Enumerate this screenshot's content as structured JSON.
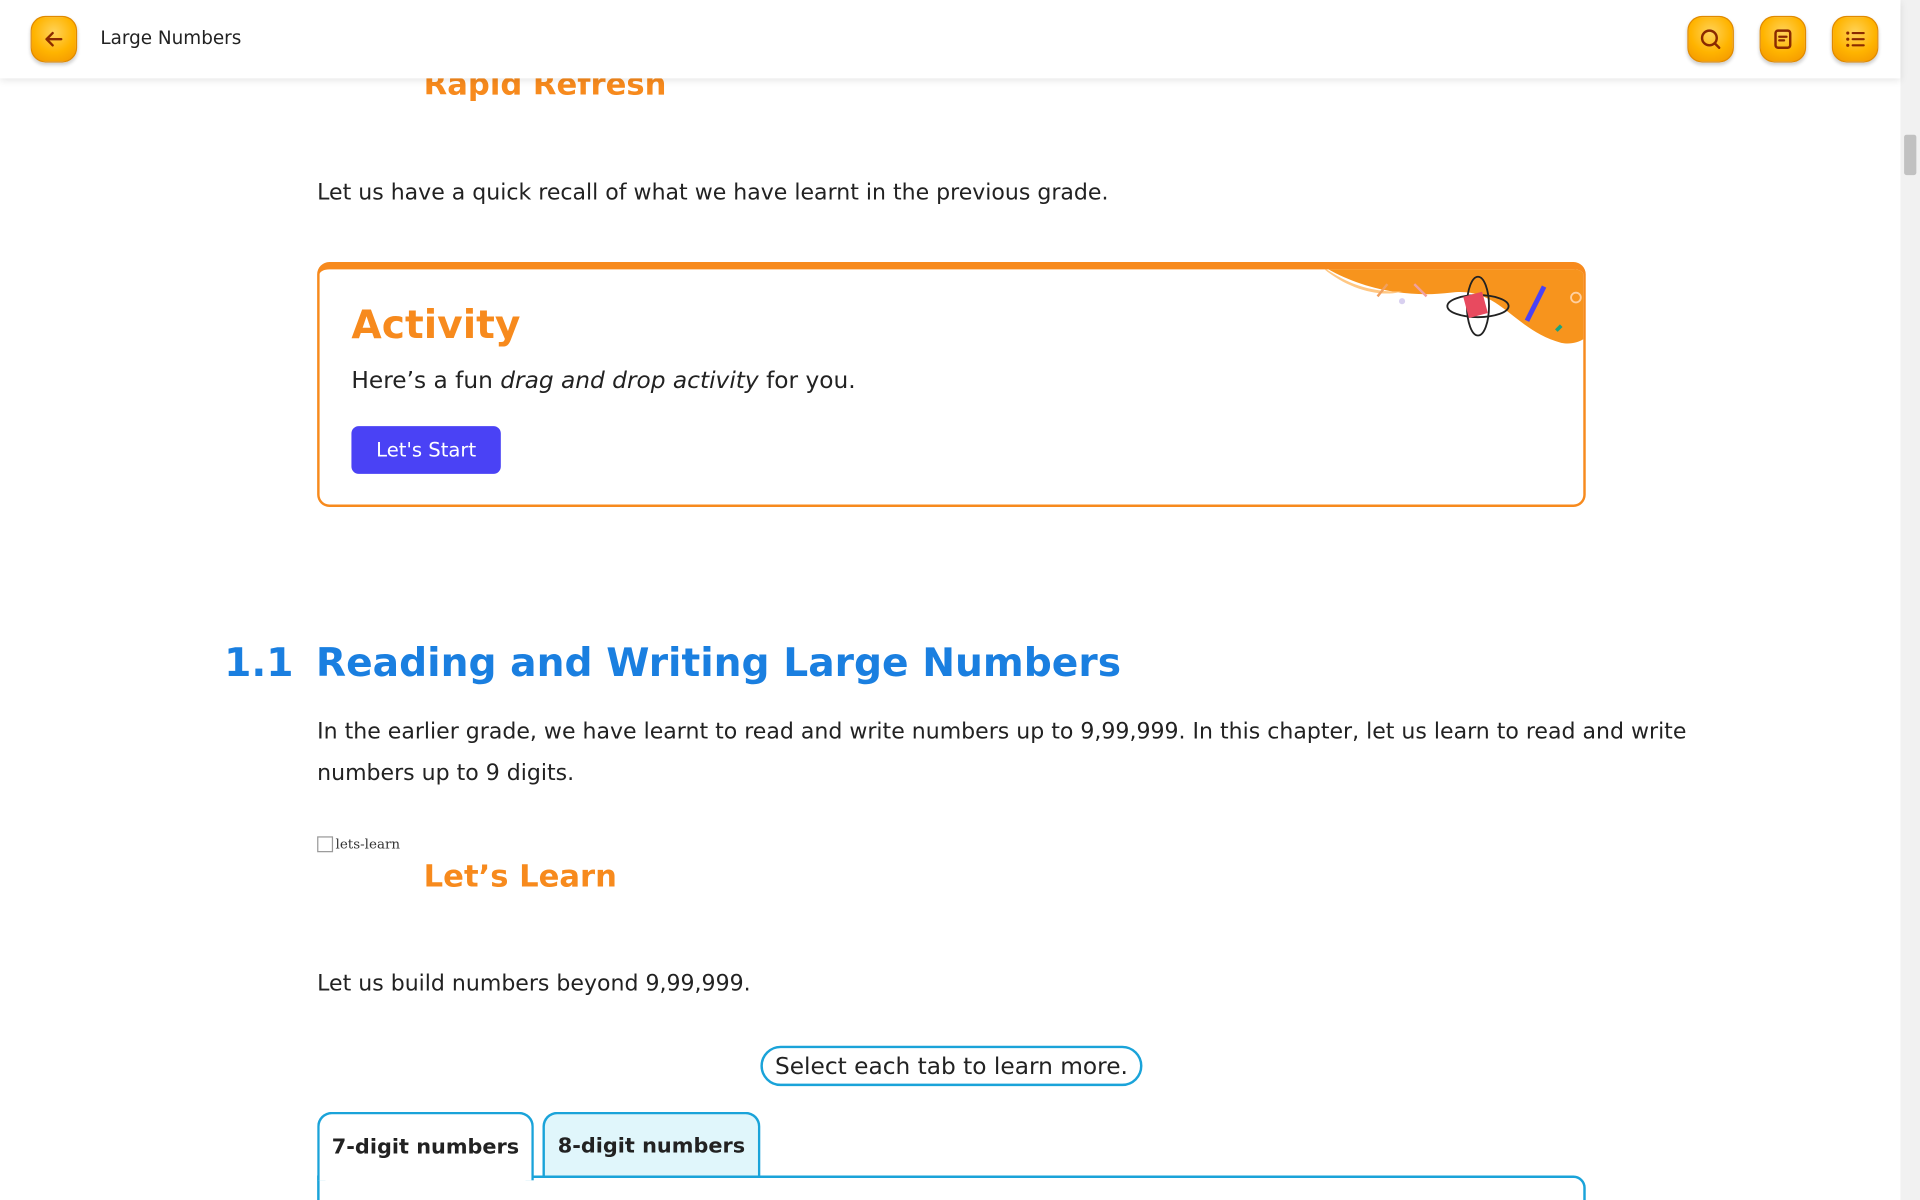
{
  "header": {
    "title": "Large Numbers",
    "back_icon": "arrow-left-icon",
    "search_icon": "search-icon",
    "notes_icon": "notes-icon",
    "menu_icon": "list-menu-icon",
    "accent_color": "#ffb400"
  },
  "rapid_refresh": {
    "heading": "Rapid Refresh",
    "text": "Let us have a quick recall of what we have learnt in the previous grade."
  },
  "activity": {
    "title": "Activity",
    "text_before": "Here’s a fun ",
    "text_italic": "drag and drop activity",
    "text_after": " for you.",
    "button_label": "Let's Start",
    "border_color": "#f78a1d",
    "button_color": "#4a42f5"
  },
  "section": {
    "number": "1.1",
    "title": "Reading and Writing Large Numbers",
    "paragraph_line1": "In the earlier grade, we have learnt to read and write numbers up to 9,99,999. In this chapter, let us learn to read and write",
    "paragraph_line2": "numbers up to 9 digits.",
    "color": "#1a7fe0"
  },
  "lets_learn": {
    "image_alt": "lets-learn",
    "heading": "Let’s Learn",
    "text": "Let us build numbers beyond 9,99,999."
  },
  "tabs": {
    "hint": "Select each tab to learn more.",
    "items": [
      {
        "label": "7-digit numbers",
        "active": true
      },
      {
        "label": "8-digit numbers",
        "active": false
      }
    ]
  }
}
